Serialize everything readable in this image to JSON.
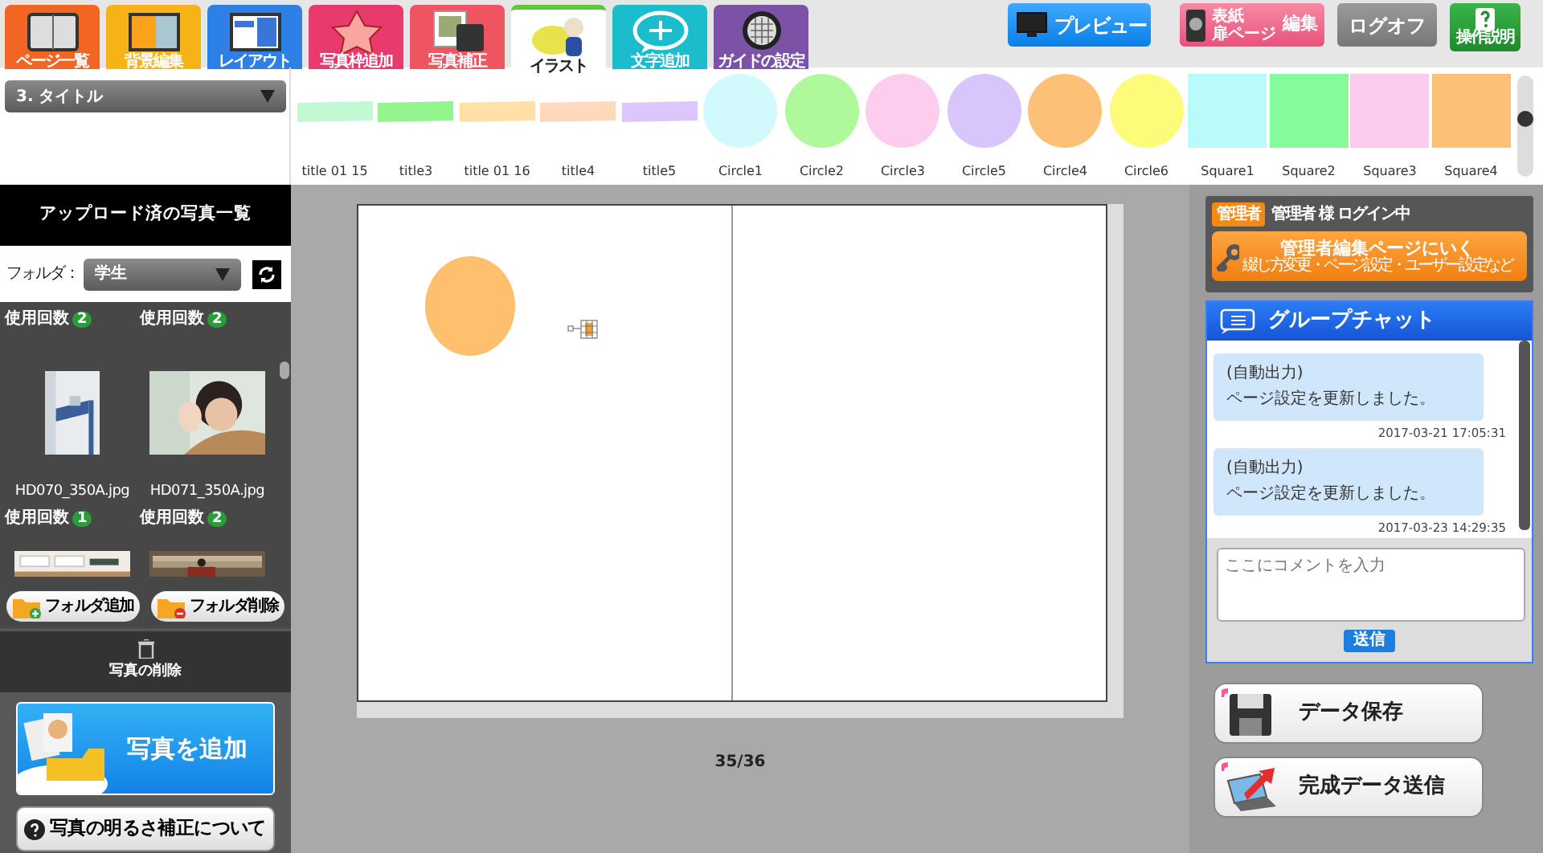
{
  "tabs": [
    {
      "label": "ページ一覧",
      "color": "#f26522",
      "selected": false
    },
    {
      "label": "背景編集",
      "color": "#f5b316",
      "selected": false
    },
    {
      "label": "レイアウト",
      "color": "#2f80e6",
      "selected": false
    },
    {
      "label": "写真枠追加",
      "color": "#e83a6c",
      "selected": false
    },
    {
      "label": "写真補正",
      "color": "#ef5560",
      "selected": false
    },
    {
      "label": "イラスト",
      "color": "#5cc93b",
      "selected": true
    },
    {
      "label": "文字追加",
      "color": "#1bbccc",
      "selected": false
    },
    {
      "label": "ガイドの設定",
      "color": "#7c52a6",
      "selected": false
    }
  ],
  "header_buttons": [
    {
      "kind": "preview",
      "label": "プレビュー"
    },
    {
      "kind": "cover",
      "label_lines": [
        "表紙",
        "扉ページ"
      ],
      "label2": "編集"
    },
    {
      "kind": "logoff",
      "label": "ログオフ"
    },
    {
      "kind": "help",
      "label": "操作説明"
    }
  ],
  "category_select": {
    "value": "3. タイトル"
  },
  "stamps": [
    {
      "label": "title 01 15",
      "kind": "strip",
      "color": "#c3f8d4"
    },
    {
      "label": "title3",
      "kind": "strip",
      "color": "#94f58f"
    },
    {
      "label": "title 01 16",
      "kind": "strip",
      "color": "#ffe0a6"
    },
    {
      "label": "title4",
      "kind": "strip",
      "color": "#ffd8bd"
    },
    {
      "label": "title5",
      "kind": "strip",
      "color": "#dcc6fb"
    },
    {
      "label": "Circle1",
      "kind": "circle",
      "color": "#d2fafd"
    },
    {
      "label": "Circle2",
      "kind": "circle",
      "color": "#b0f89c"
    },
    {
      "label": "Circle3",
      "kind": "circle",
      "color": "#fdcdee"
    },
    {
      "label": "Circle5",
      "kind": "circle",
      "color": "#d7c5fb"
    },
    {
      "label": "Circle4",
      "kind": "circle",
      "color": "#fdc077"
    },
    {
      "label": "Circle6",
      "kind": "circle",
      "color": "#fdfc7a"
    },
    {
      "label": "Square1",
      "kind": "square",
      "color": "#bafafa"
    },
    {
      "label": "Square2",
      "kind": "square",
      "color": "#86fb9c"
    },
    {
      "label": "Square3",
      "kind": "square",
      "color": "#fdcbed"
    },
    {
      "label": "Square4",
      "kind": "square",
      "color": "#fdc077"
    }
  ],
  "sidebar": {
    "title": "アップロード済の写真一覧",
    "folder_label": "フォルダ：",
    "folder_value": "学生",
    "photos": [
      {
        "usage_label": "使用回数",
        "count": "2"
      },
      {
        "usage_label": "使用回数",
        "count": "2"
      },
      {
        "kind": "picture",
        "filename": "HD070_350A.jpg",
        "usage_label": "使用回数",
        "count": "1"
      },
      {
        "kind": "picture",
        "filename": "HD071_350A.jpg",
        "usage_label": "使用回数",
        "count": "2"
      },
      {
        "kind": "picture"
      },
      {
        "kind": "picture"
      }
    ],
    "folder_buttons": [
      "フォルダ追加",
      "フォルダ削除"
    ],
    "delete_label": "写真の削除",
    "add_button": "写真を追加",
    "brightness_button": "写真の明るさ補正について"
  },
  "page_indicator": "35/36",
  "admin": {
    "badge": "管理者",
    "status": "管理者 様 ログイン中",
    "button": "管理者編集ページにいく",
    "button_sub": "綴じ方変更・ページ設定・ユーザー設定など"
  },
  "chat": {
    "title": "グループチャット",
    "messages": [
      {
        "lines": [
          "(自動出力)",
          "ページ設定を更新しました。"
        ],
        "time": "2017-03-21 17:05:31"
      },
      {
        "lines": [
          "(自動出力)",
          "ページ設定を更新しました。"
        ],
        "time": "2017-03-23 14:29:35"
      }
    ],
    "placeholder": "ここにコメントを入力",
    "send": "送信"
  },
  "action_buttons": [
    "データ保存",
    "完成データ送信"
  ]
}
